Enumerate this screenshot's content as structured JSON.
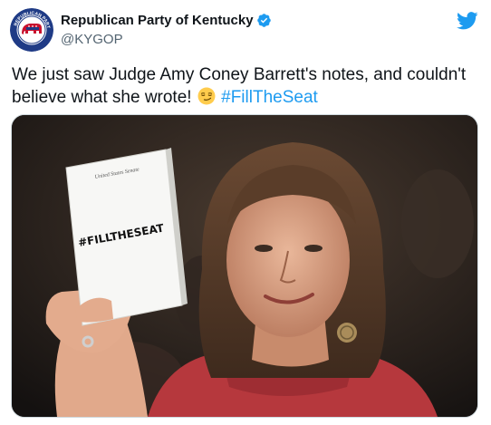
{
  "author": {
    "display_name": "Republican Party of Kentucky",
    "handle": "@KYGOP",
    "avatar_icon": "kentucky-gop-seal-icon",
    "verified_icon": "verified-badge-icon",
    "verified_color": "#1d9bf0",
    "avatar_ring_text": "REPUBLICAN PARTY OF KENTUCKY"
  },
  "brand": {
    "icon": "twitter-bird-icon",
    "color": "#1d9bf0"
  },
  "tweet": {
    "text_line1": "We just saw Judge Amy Coney Barrett's notes, and couldn't",
    "text_line2_prefix": "believe what she wrote!",
    "emoji_icon": "smirking-face-emoji",
    "hashtag": "#FillTheSeat",
    "hashtag_color": "#1d9bf0"
  },
  "media": {
    "notebook_text": "#FILLTHESEAT",
    "notebook_header": "United States Senate"
  }
}
